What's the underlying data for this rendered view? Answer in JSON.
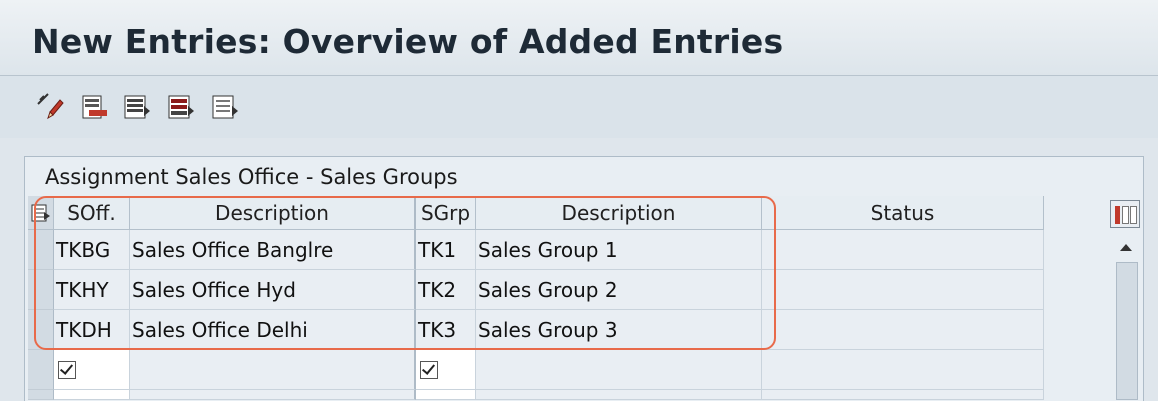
{
  "window": {
    "title": "New Entries: Overview of Added Entries"
  },
  "toolbar": {
    "buttons": [
      {
        "icon": "display-change-icon"
      },
      {
        "icon": "delimit-icon"
      },
      {
        "icon": "select-all-icon"
      },
      {
        "icon": "select-block-icon"
      },
      {
        "icon": "deselect-all-icon"
      }
    ]
  },
  "panel": {
    "title": "Assignment Sales Office - Sales Groups"
  },
  "table": {
    "headers": {
      "soff": "SOff.",
      "soff_desc": "Description",
      "sgrp": "SGrp",
      "sgrp_desc": "Description",
      "status": "Status"
    },
    "rows": [
      {
        "soff": "TKBG",
        "soff_desc": "Sales Office Banglre",
        "sgrp": "TK1",
        "sgrp_desc": "Sales Group 1",
        "status": ""
      },
      {
        "soff": "TKHY",
        "soff_desc": "Sales Office Hyd",
        "sgrp": "TK2",
        "sgrp_desc": "Sales Group 2",
        "status": ""
      },
      {
        "soff": "TKDH",
        "soff_desc": "Sales Office Delhi",
        "sgrp": "TK3",
        "sgrp_desc": "Sales Group 3",
        "status": ""
      }
    ]
  },
  "colors": {
    "highlight": "#e86a4a",
    "title_bar": "#e6ecf1",
    "panel": "#e8eef3"
  }
}
